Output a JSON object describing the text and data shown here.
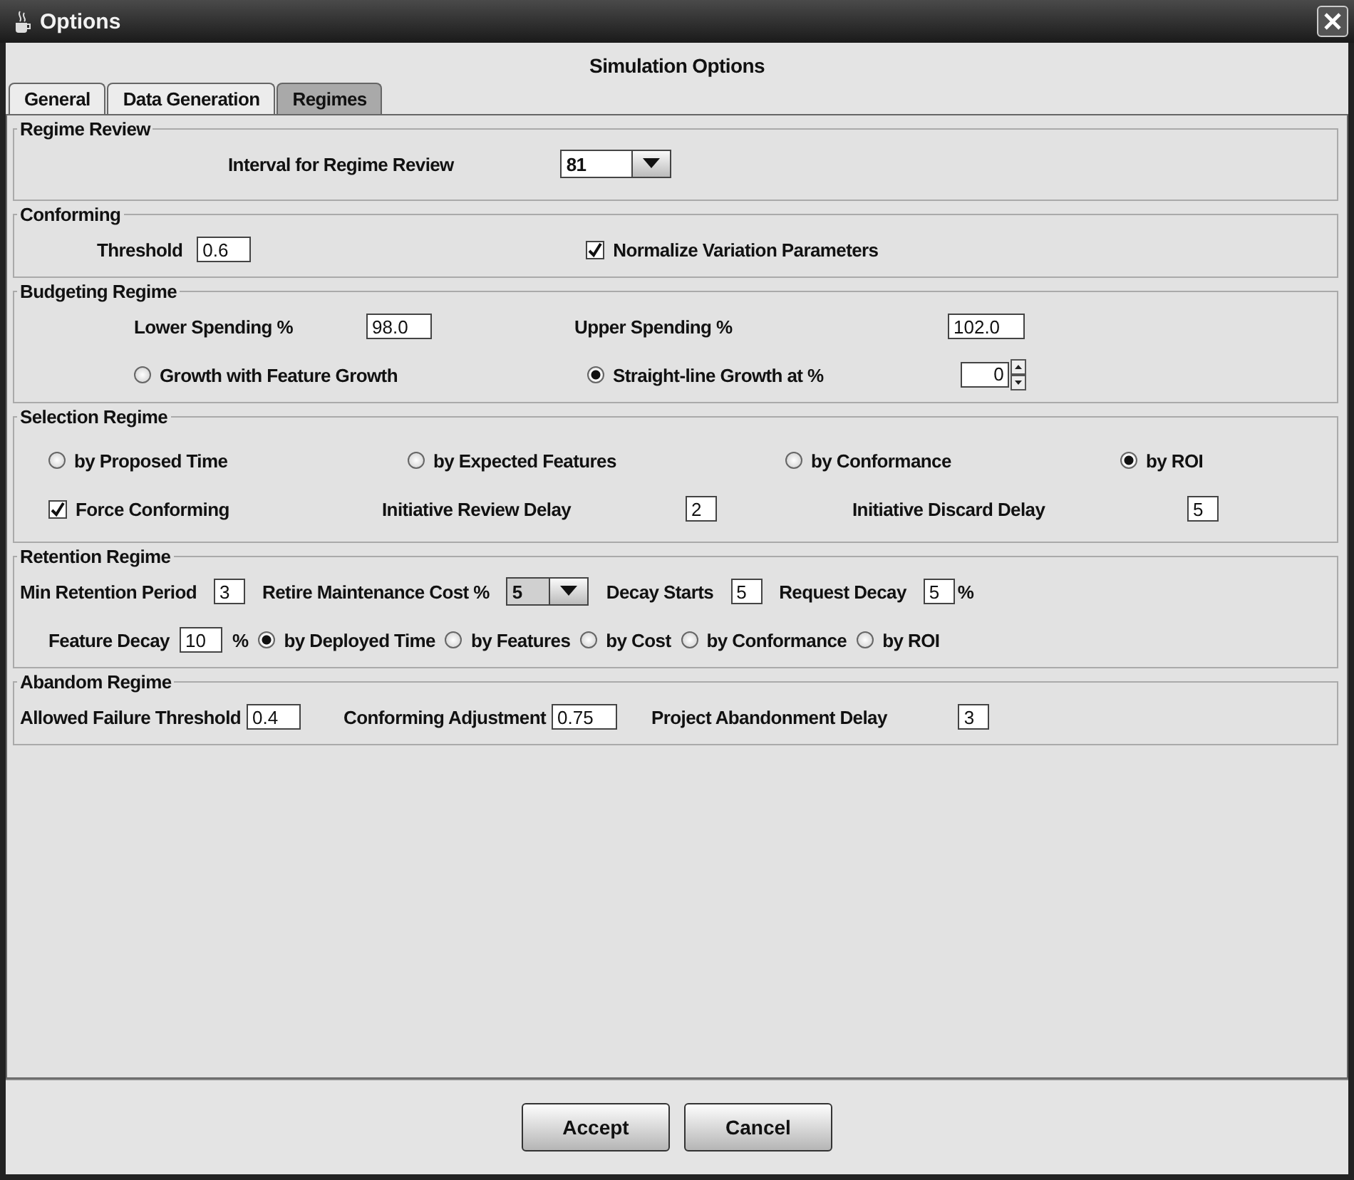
{
  "window": {
    "title": "Options"
  },
  "heading": "Simulation Options",
  "tabs": [
    {
      "label": "General",
      "selected": false
    },
    {
      "label": "Data Generation",
      "selected": false
    },
    {
      "label": "Regimes",
      "selected": true
    }
  ],
  "sections": [
    {
      "title": "Regime Review",
      "lines": [
        {
          "items": [
            {
              "kind": "label",
              "text": "Interval for Regime Review"
            },
            {
              "kind": "combo",
              "value": "81"
            }
          ]
        }
      ]
    },
    {
      "title": "Conforming",
      "lines": [
        {
          "items": [
            {
              "kind": "label",
              "text": "Threshold"
            },
            {
              "kind": "field",
              "value": "0.6"
            },
            {
              "kind": "checkbox",
              "label": "Normalize Variation Parameters",
              "checked": true
            }
          ]
        }
      ]
    },
    {
      "title": "Budgeting Regime",
      "lines": [
        {
          "items": [
            {
              "kind": "label",
              "text": "Lower Spending %"
            },
            {
              "kind": "field",
              "value": "98.0"
            },
            {
              "kind": "label",
              "text": "Upper Spending %"
            },
            {
              "kind": "field",
              "value": "102.0"
            }
          ]
        },
        {
          "items": [
            {
              "kind": "radio",
              "label": "Growth with Feature Growth",
              "selected": false
            },
            {
              "kind": "radio",
              "label": "Straight-line Growth at %",
              "selected": true
            },
            {
              "kind": "spinner",
              "value": "0"
            }
          ]
        }
      ]
    },
    {
      "title": "Selection Regime",
      "lines": [
        {
          "items": [
            {
              "kind": "radio",
              "label": "by Proposed Time",
              "selected": false
            },
            {
              "kind": "radio",
              "label": "by Expected Features",
              "selected": false
            },
            {
              "kind": "radio",
              "label": "by Conformance",
              "selected": false
            },
            {
              "kind": "radio",
              "label": "by ROI",
              "selected": true
            }
          ]
        },
        {
          "items": [
            {
              "kind": "checkbox",
              "label": "Force Conforming",
              "checked": true
            },
            {
              "kind": "label",
              "text": "Initiative Review Delay"
            },
            {
              "kind": "field",
              "value": "2"
            },
            {
              "kind": "label",
              "text": "Initiative Discard Delay"
            },
            {
              "kind": "field",
              "value": "5"
            }
          ]
        }
      ]
    },
    {
      "title": "Retention Regime",
      "lines": [
        {
          "items": [
            {
              "kind": "label",
              "text": "Min Retention Period"
            },
            {
              "kind": "field",
              "value": "3"
            },
            {
              "kind": "label",
              "text": "Retire Maintenance Cost %"
            },
            {
              "kind": "combo",
              "value": "5"
            },
            {
              "kind": "label",
              "text": "Decay Starts"
            },
            {
              "kind": "field",
              "value": "5"
            },
            {
              "kind": "label",
              "text": "Request Decay"
            },
            {
              "kind": "field",
              "value": "5"
            },
            {
              "kind": "label",
              "text": "%"
            }
          ]
        },
        {
          "items": [
            {
              "kind": "label",
              "text": "Feature Decay"
            },
            {
              "kind": "field",
              "value": "10"
            },
            {
              "kind": "label",
              "text": "%"
            },
            {
              "kind": "radio",
              "label": "by Deployed Time",
              "selected": true
            },
            {
              "kind": "radio",
              "label": "by Features",
              "selected": false
            },
            {
              "kind": "radio",
              "label": "by Cost",
              "selected": false
            },
            {
              "kind": "radio",
              "label": "by Conformance",
              "selected": false
            },
            {
              "kind": "radio",
              "label": "by ROI",
              "selected": false
            }
          ]
        }
      ]
    },
    {
      "title": "Abandom Regime",
      "lines": [
        {
          "items": [
            {
              "kind": "label",
              "text": "Allowed Failure Threshold"
            },
            {
              "kind": "field",
              "value": "0.4"
            },
            {
              "kind": "label",
              "text": "Conforming Adjustment"
            },
            {
              "kind": "field",
              "value": "0.75"
            },
            {
              "kind": "label",
              "text": "Project Abandonment Delay"
            },
            {
              "kind": "field",
              "value": "3"
            }
          ]
        }
      ]
    }
  ],
  "buttons": [
    "Accept",
    "Cancel"
  ]
}
